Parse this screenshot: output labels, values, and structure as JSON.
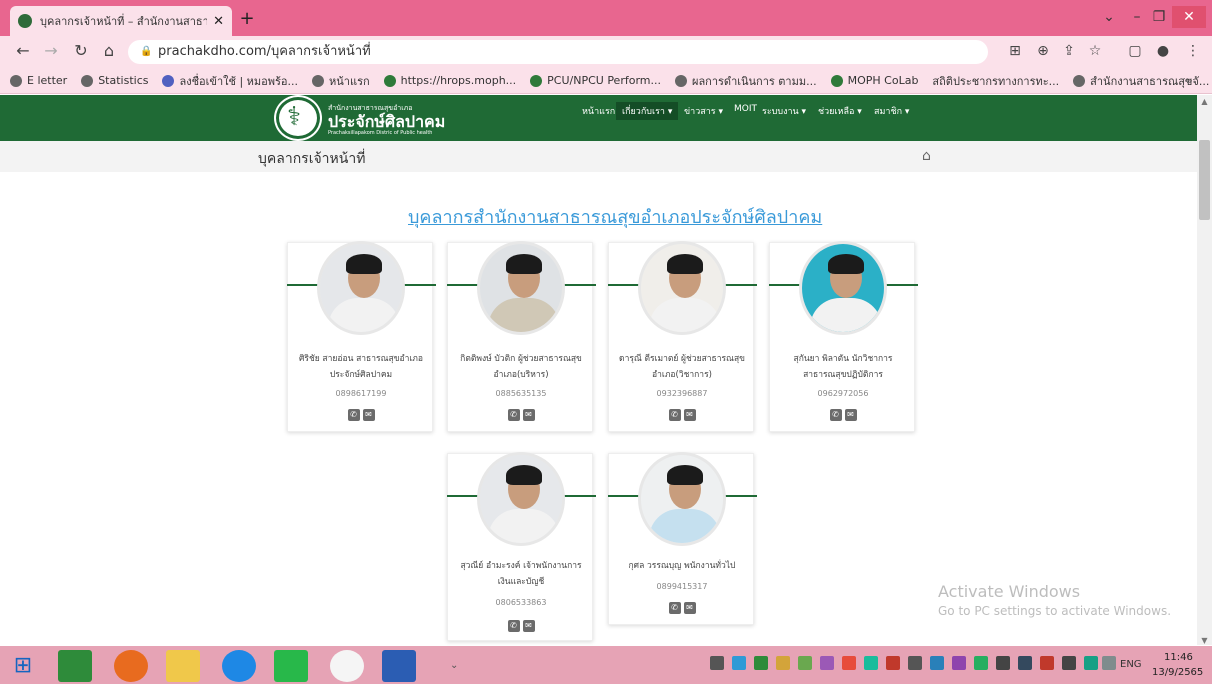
{
  "browser": {
    "tab_title": "บุคลากรเจ้าหน้าที่ – สำนักงานสาธารณ",
    "url": "prachakdho.com/บุคลากรเจ้าหน้าที่",
    "bookmarks": [
      {
        "label": "E letter",
        "icon": "globe-icon"
      },
      {
        "label": "Statistics",
        "icon": "globe-icon"
      },
      {
        "label": "ลงชื่อเข้าใช้ | หมอพร้อ...",
        "icon": "bars-icon"
      },
      {
        "label": "หน้าแรก",
        "icon": "d-logo-icon"
      },
      {
        "label": "https://hrops.moph...",
        "icon": "moph-icon"
      },
      {
        "label": "PCU/NPCU Perform...",
        "icon": "drive-icon"
      },
      {
        "label": "ผลการดำเนินการ ตามม...",
        "icon": "globe-icon"
      },
      {
        "label": "MOPH CoLab",
        "icon": "colab-icon"
      },
      {
        "label": "สถิติประชากรทางการทะ...",
        "icon": "none"
      },
      {
        "label": "สำนักงานสาธารณสุขจั...",
        "icon": "globe-icon"
      }
    ],
    "more_bookmarks": "»"
  },
  "site": {
    "small_title": "สำนักงานสาธารณสุขอำเภอ",
    "name": "ประจักษ์ศิลปาคม",
    "english": "Prachaksillapakom Distric of Public health",
    "menu": [
      "หน้าแรก",
      "เกี่ยวกับเรา ▾",
      "ข่าวสาร ▾",
      "MOIT",
      "ระบบงาน ▾",
      "ช่วยเหลือ ▾",
      "สมาชิก ▾"
    ]
  },
  "breadcrumb": {
    "title": "บุคลากรเจ้าหน้าที่"
  },
  "heading": "บุคลากรสำนักงานสาธารณสุขอำเภอประจักษ์ศิลปาคม",
  "staff": [
    {
      "name_line1": "ศิริชัย สายอ่อน สาธารณสุขอำเภอ",
      "name_line2": "ประจักษ์ศิลปาคม",
      "phone": "0898617199"
    },
    {
      "name_line1": "กิตติพงษ์ บัวติก ผู้ช่วยสาธารณสุข",
      "name_line2": "อำเภอ(บริหาร)",
      "phone": "0885635135"
    },
    {
      "name_line1": "ดารุณี ตีรเมาตย์ ผู้ช่วยสาธารณสุข",
      "name_line2": "อำเภอ(วิชาการ)",
      "phone": "0932396887"
    },
    {
      "name_line1": "สุกันยา พิลาตัน นักวิชาการ",
      "name_line2": "สาธารณสุขปฏิบัติการ",
      "phone": "0962972056"
    },
    {
      "name_line1": "สุวณีย์ อำมะรงค์ เจ้าพนักงานการ",
      "name_line2": "เงินและบัญชี",
      "phone": "0806533863"
    },
    {
      "name_line1": "กุศล วรรณบุญ พนักงานทั่วไป",
      "name_line2": "",
      "phone": "0899415317"
    }
  ],
  "watermark": {
    "line1": "Activate Windows",
    "line2": "Go to PC settings to activate Windows."
  },
  "taskbar": {
    "lang": "ENG",
    "time": "11:46",
    "date": "13/9/2565"
  }
}
